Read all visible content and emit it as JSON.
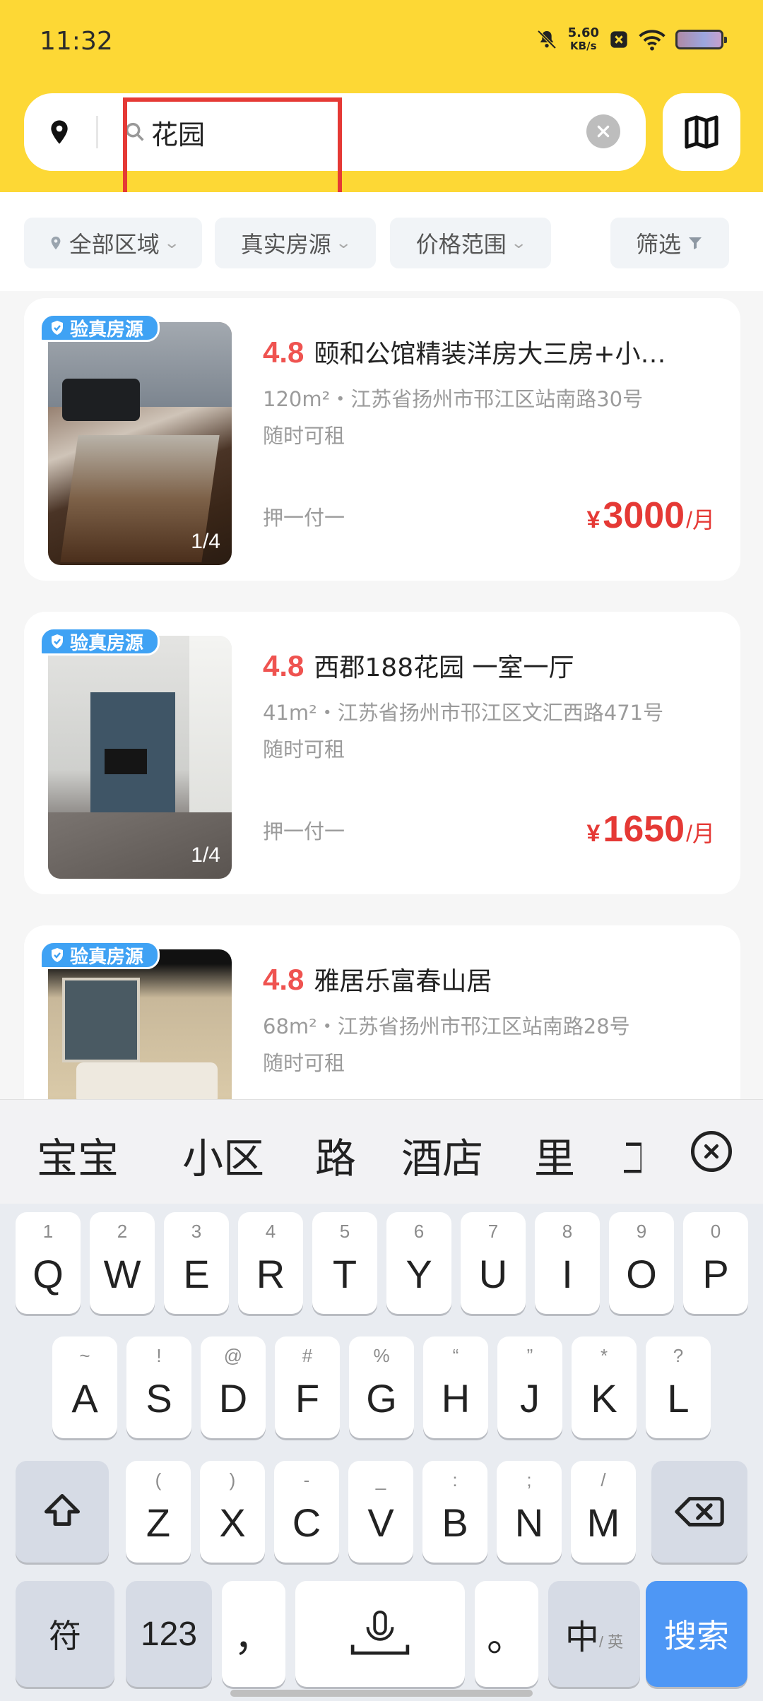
{
  "status": {
    "time": "11:32",
    "net_speed": "5.60",
    "net_unit": "KB/s"
  },
  "search": {
    "query": "花园"
  },
  "filters": [
    {
      "label": "全部区域"
    },
    {
      "label": "真实房源"
    },
    {
      "label": "价格范围"
    },
    {
      "label": "筛选"
    }
  ],
  "listings": [
    {
      "badge": "验真房源",
      "rating": "4.8",
      "title": "颐和公馆精装洋房大三房+小…",
      "meta": "120m²・江苏省扬州市邗江区站南路30号",
      "availability": "随时可租",
      "deposit": "押一付一",
      "currency": "¥",
      "price": "3000",
      "unit": "/月",
      "photo_count": "1/4"
    },
    {
      "badge": "验真房源",
      "rating": "4.8",
      "title": "西郡188花园 一室一厅",
      "meta": "41m²・江苏省扬州市邗江区文汇西路471号",
      "availability": "随时可租",
      "deposit": "押一付一",
      "currency": "¥",
      "price": "1650",
      "unit": "/月",
      "photo_count": "1/4"
    },
    {
      "badge": "验真房源",
      "rating": "4.8",
      "title": "雅居乐富春山居",
      "meta": "68m²・江苏省扬州市邗江区站南路28号",
      "availability": "随时可租"
    }
  ],
  "keyboard": {
    "candidates": [
      "宝宝",
      "小区",
      "路",
      "酒店",
      "里",
      "工"
    ],
    "row1": [
      {
        "k": "Q",
        "n": "1"
      },
      {
        "k": "W",
        "n": "2"
      },
      {
        "k": "E",
        "n": "3"
      },
      {
        "k": "R",
        "n": "4"
      },
      {
        "k": "T",
        "n": "5"
      },
      {
        "k": "Y",
        "n": "6"
      },
      {
        "k": "U",
        "n": "7"
      },
      {
        "k": "I",
        "n": "8"
      },
      {
        "k": "O",
        "n": "9"
      },
      {
        "k": "P",
        "n": "0"
      }
    ],
    "row2": [
      {
        "k": "A",
        "n": "~"
      },
      {
        "k": "S",
        "n": "!"
      },
      {
        "k": "D",
        "n": "@"
      },
      {
        "k": "F",
        "n": "#"
      },
      {
        "k": "G",
        "n": "%"
      },
      {
        "k": "H",
        "n": "“"
      },
      {
        "k": "J",
        "n": "”"
      },
      {
        "k": "K",
        "n": "*"
      },
      {
        "k": "L",
        "n": "?"
      }
    ],
    "row3": [
      {
        "k": "Z",
        "n": "("
      },
      {
        "k": "X",
        "n": ")"
      },
      {
        "k": "C",
        "n": "-"
      },
      {
        "k": "V",
        "n": "_"
      },
      {
        "k": "B",
        "n": ":"
      },
      {
        "k": "N",
        "n": ";"
      },
      {
        "k": "M",
        "n": "/"
      }
    ],
    "symbols_label": "符",
    "numbers_label": "123",
    "comma": "，",
    "period": "。",
    "lang_main": "中",
    "lang_sub": "/ 英",
    "search_label": "搜索"
  }
}
